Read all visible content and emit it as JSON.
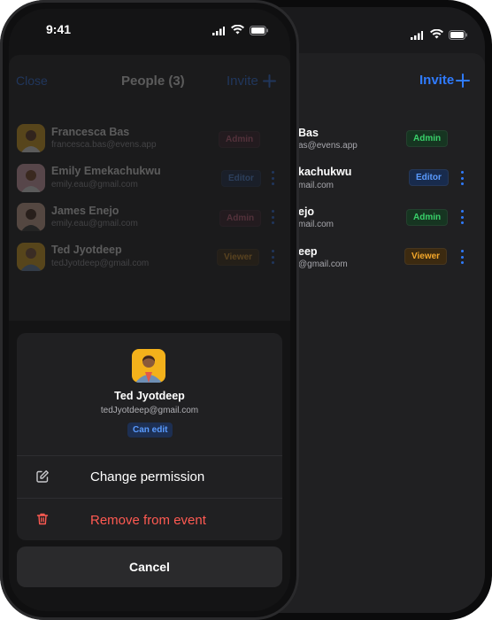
{
  "status_bar": {
    "time": "9:41"
  },
  "header": {
    "close_label": "Close",
    "title": "People (3)",
    "invite_label": "Invite"
  },
  "people": [
    {
      "name": "Francesca Bas",
      "email": "francesca.bas@evens.app",
      "role": "Admin",
      "back_name": "Bas",
      "back_email": "as@evens.app"
    },
    {
      "name": "Emily Emekachukwu",
      "email": "emily.eau@gmail.com",
      "role": "Editor",
      "back_name": "kachukwu",
      "back_email": "mail.com"
    },
    {
      "name": "James Enejo",
      "email": "emily.eau@gmail.com",
      "role": "Admin",
      "back_name": "ejo",
      "back_email": "mail.com"
    },
    {
      "name": "Ted Jyotdeep",
      "email": "tedJyotdeep@gmail.com",
      "role": "Viewer",
      "back_name": "eep",
      "back_email": "@gmail.com"
    }
  ],
  "sheet": {
    "name": "Ted Jyotdeep",
    "email": "tedJyotdeep@gmail.com",
    "permission_badge": "Can edit",
    "change_permission_label": "Change permission",
    "remove_label": "Remove from event",
    "cancel_label": "Cancel"
  },
  "colors": {
    "accent": "#2f7bff",
    "danger": "#ff5a52",
    "admin": "#39d16a",
    "editor": "#5a9bff",
    "viewer": "#f4a72a"
  },
  "icons": {
    "edit": "pencil-square-icon",
    "remove": "trash-icon",
    "add": "plus-icon",
    "more": "vertical-dots-icon"
  }
}
